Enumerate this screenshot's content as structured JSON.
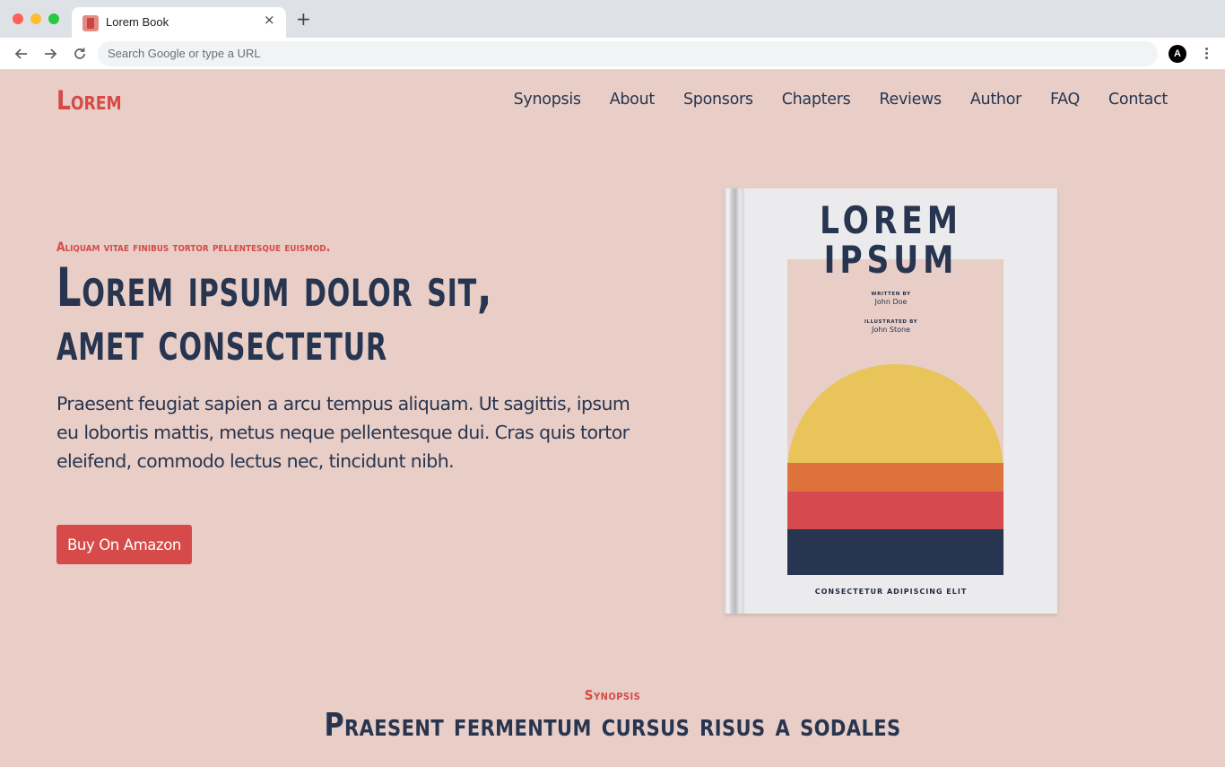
{
  "browser": {
    "tab_title": "Lorem Book",
    "tab_close_glyph": "×",
    "new_tab_glyph": "+",
    "omnibox_placeholder": "Search Google or type a URL",
    "profile_initial": "A"
  },
  "header": {
    "logo": "Lorem",
    "nav": [
      "Synopsis",
      "About",
      "Sponsors",
      "Chapters",
      "Reviews",
      "Author",
      "FAQ",
      "Contact"
    ]
  },
  "hero": {
    "eyebrow": "Aliquam vitae finibus tortor pellentesque euismod.",
    "title_line1": "Lorem ipsum dolor sit,",
    "title_line2": "amet consectetur",
    "body": "Praesent feugiat sapien a arcu tempus aliquam. Ut sagittis, ipsum eu lobortis mattis, metus neque pellentesque dui. Cras quis tortor eleifend, commodo lectus nec, tincidunt nibh.",
    "cta": "Buy On Amazon"
  },
  "book": {
    "title_line1": "LOREM",
    "title_line2": "IPSUM",
    "written_by_label": "WRITTEN BY",
    "author": "John Doe",
    "illustrated_by_label": "ILLUSTRATED BY",
    "illustrator": "John Stone",
    "tagline": "CONSECTETUR ADIPISCING ELIT"
  },
  "synopsis": {
    "label": "Synopsis",
    "title": "Praesent fermentum cursus risus a sodales"
  },
  "colors": {
    "accent": "#d64a49",
    "navy": "#283550",
    "background": "#e8cec6",
    "sun": "#e8c45a",
    "orange": "#dd733a"
  }
}
